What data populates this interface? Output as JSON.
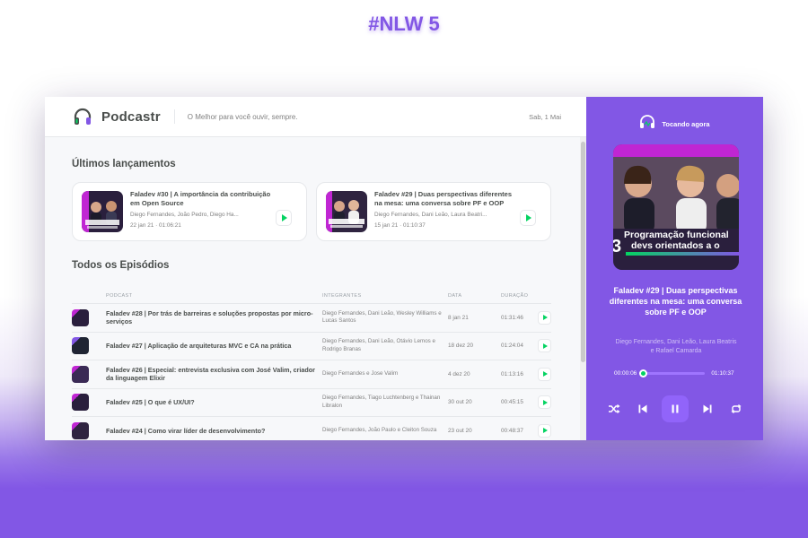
{
  "page": {
    "hashtag": "#NLW 5"
  },
  "header": {
    "logo_text": "Podcastr",
    "tagline": "O Melhor para você ouvir, sempre.",
    "date": "Sab, 1 Mai"
  },
  "latest": {
    "title": "Últimos lançamentos",
    "items": [
      {
        "title": "Faladev #30 | A importância da contribuição em Open Source",
        "members": "Diego Fernandes, João Pedro, Diego Ha...",
        "meta": "22 jan 21 · 01:06:21"
      },
      {
        "title": "Faladev #29 | Duas perspectivas diferentes na mesa: uma conversa sobre PF e OOP",
        "members": "Diego Fernandes, Dani Leão, Laura Beatri...",
        "meta": "15 jan 21 · 01:10:37"
      }
    ]
  },
  "all_episodes": {
    "title": "Todos os Episódios",
    "columns": [
      "Podcast",
      "Integrantes",
      "Data",
      "Duração"
    ],
    "rows": [
      {
        "title": "Faladev #28 | Por trás de barreiras e soluções propostas por micro-serviços",
        "members": "Diego Fernandes, Dani Leão, Wesley Williams e Lucas Santos",
        "date": "8 jan 21",
        "duration": "01:31:46"
      },
      {
        "title": "Faladev #27 | Aplicação de arquiteturas MVC e CA na prática",
        "members": "Diego Fernandes, Dani Leão, Otávio Lemos e Rodrigo Branas",
        "date": "18 dez 20",
        "duration": "01:24:04"
      },
      {
        "title": "Faladev #26 | Especial: entrevista exclusiva com José Valim, criador da linguagem Elixir",
        "members": "Diego Fernandes e Jose Valim",
        "date": "4 dez 20",
        "duration": "01:13:16"
      },
      {
        "title": "Faladev #25 | O que é UX/UI?",
        "members": "Diego Fernandes, Tiago Luchtenberg e Thainan Libralon",
        "date": "30 out 20",
        "duration": "00:45:15"
      },
      {
        "title": "Faladev #24 | Como virar líder de desenvolvimento?",
        "members": "Diego Fernandes, João Paulo e Cleiton Souza",
        "date": "23 out 20",
        "duration": "00:48:37"
      }
    ]
  },
  "player": {
    "header_label": "Tocando agora",
    "cover_text": "Programação funcional para devs orientados a objetos",
    "title": "Faladev #29 | Duas perspectivas diferentes na mesa: uma conversa sobre PF e OOP",
    "members": "Diego Fernandes, Dani Leão, Laura Beatris e Rafael Camarda",
    "current_time": "00:00:06",
    "duration": "01:10:37",
    "progress_fraction": 0.0014
  },
  "colors": {
    "accent": "#8257e5",
    "green": "#04d361",
    "text": "#494d4b"
  }
}
